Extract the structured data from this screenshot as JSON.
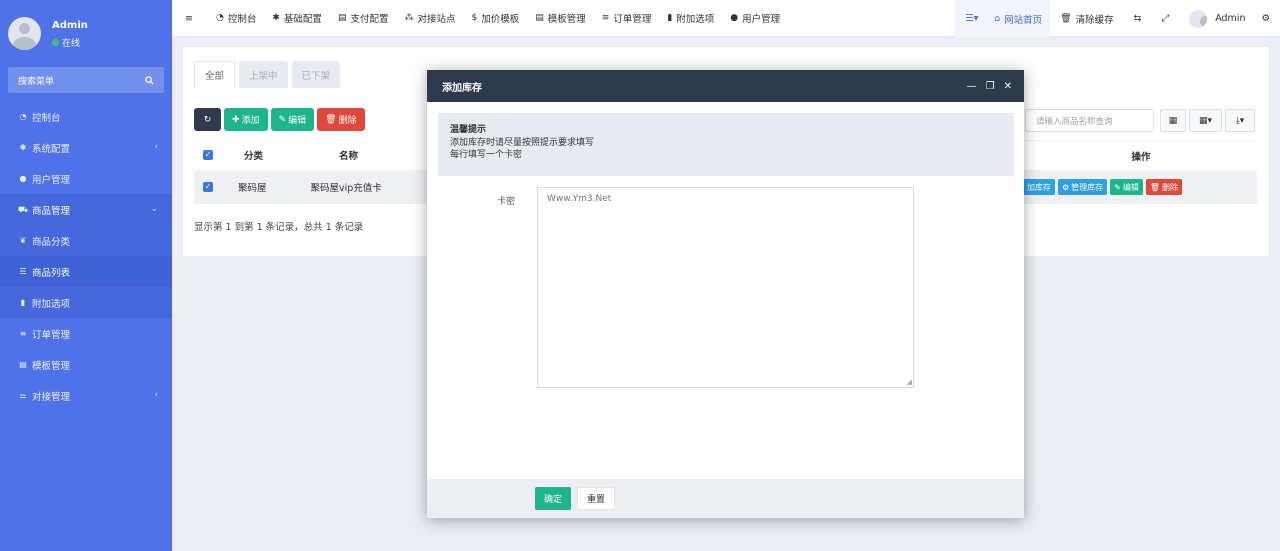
{
  "user": {
    "name": "Admin",
    "status": "在线"
  },
  "sidebar": {
    "search_placeholder": "搜索菜单",
    "items": [
      {
        "label": "控制台",
        "icon": "dashboard-icon"
      },
      {
        "label": "系统配置",
        "icon": "gear-icon",
        "arrow": "‹"
      },
      {
        "label": "用户管理",
        "icon": "user-icon"
      },
      {
        "label": "商品管理",
        "icon": "cart-icon",
        "arrow": "⌄"
      },
      {
        "label": "商品分类",
        "icon": "leaf-icon"
      },
      {
        "label": "商品列表",
        "icon": "list-icon"
      },
      {
        "label": "附加选项",
        "icon": "bookmark-icon"
      },
      {
        "label": "订单管理",
        "icon": "list-icon"
      },
      {
        "label": "模板管理",
        "icon": "template-icon"
      },
      {
        "label": "对接管理",
        "icon": "sliders-icon",
        "arrow": "‹"
      }
    ]
  },
  "topnav": {
    "items": [
      "控制台",
      "基础配置",
      "支付配置",
      "对接站点",
      "加价模板",
      "模板管理",
      "订单管理",
      "附加选项",
      "用户管理"
    ],
    "site_home": "网站首页",
    "clear_cache": "清除缓存",
    "admin": "Admin"
  },
  "panel": {
    "tabs": [
      "全部",
      "上架中",
      "已下架"
    ],
    "toolbar": {
      "add": "添加",
      "edit": "编辑",
      "delete": "删除"
    },
    "columns": {
      "category": "分类",
      "name": "名称",
      "operation": "操作"
    },
    "row": {
      "category": "聚码屋",
      "name": "聚码屋vip充值卡"
    },
    "pager": "显示第 1 到第 1 条记录，总共 1 条记录",
    "search_placeholder": "请输入商品名称查询",
    "row_actions": {
      "add_stock": "加库存",
      "manage_stock": "管理库存",
      "edit": "编辑",
      "delete": "删除"
    }
  },
  "modal": {
    "title": "添加库存",
    "tip_title": "温馨提示",
    "tip_line1": "添加库存时请尽量按照提示要求填写",
    "tip_line2": "每行填写一个卡密",
    "field_label": "卡密",
    "field_value": "Www.Ym3.Net",
    "confirm": "确定",
    "reset": "重置"
  }
}
